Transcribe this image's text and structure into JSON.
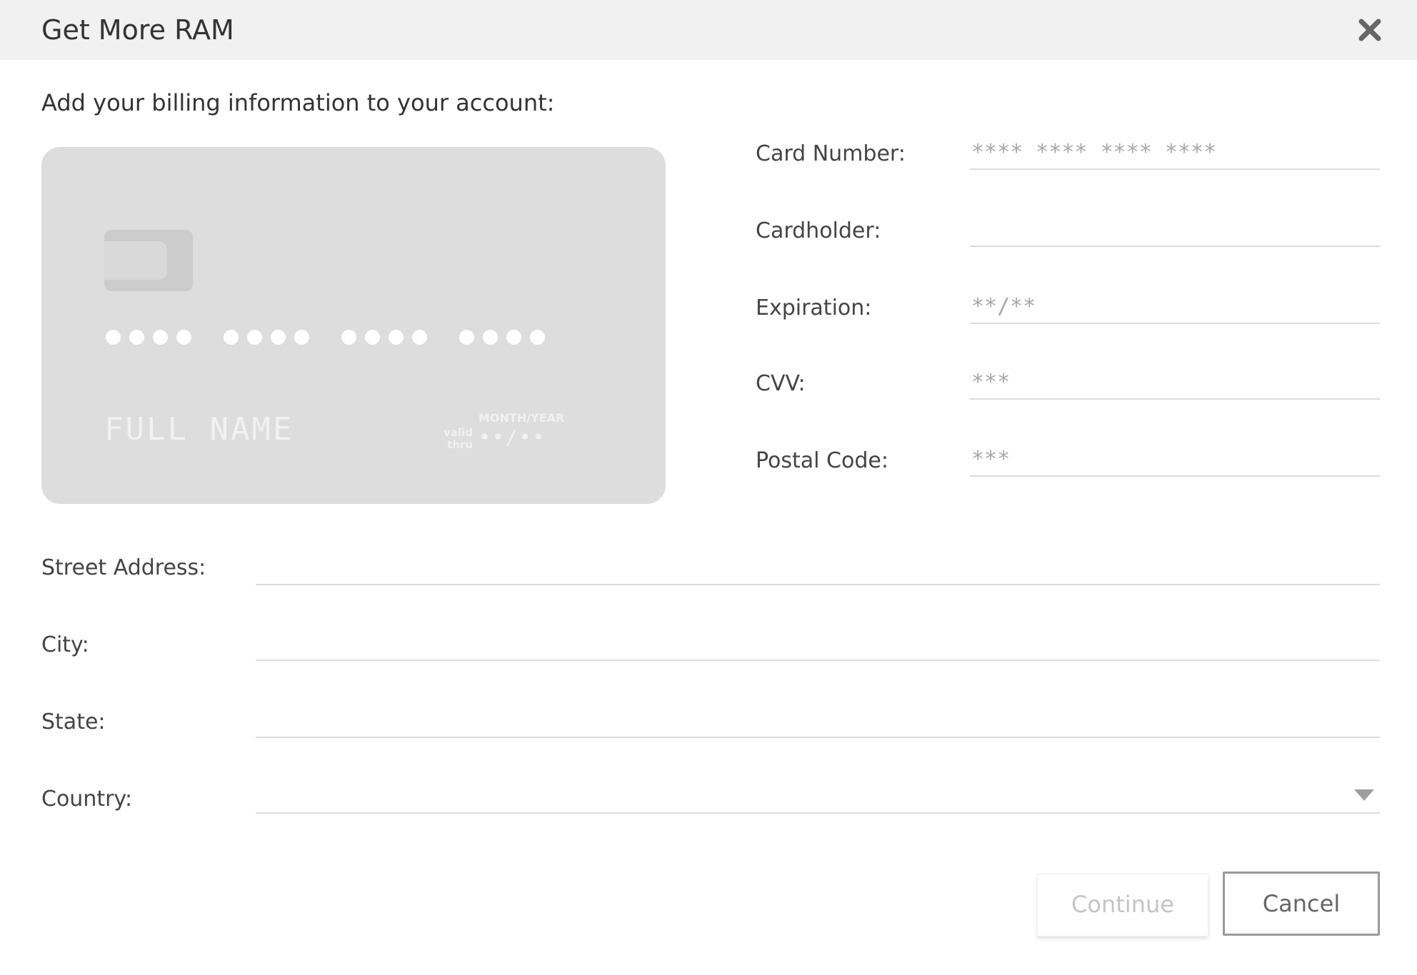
{
  "dialog": {
    "title": "Get More RAM",
    "close_icon": "close-icon",
    "intro": "Add your billing information to your account:"
  },
  "card_preview": {
    "number_mask": "•••• •••• •••• ••••",
    "name_placeholder": "FULL NAME",
    "valid_label_line1": "valid",
    "valid_label_line2": "thru",
    "expiry_label": "MONTH/YEAR",
    "expiry_mask": "••/••"
  },
  "card_fields": {
    "card_number": {
      "label": "Card Number:",
      "placeholder": "**** **** **** ****",
      "value": ""
    },
    "cardholder": {
      "label": "Cardholder:",
      "placeholder": "",
      "value": ""
    },
    "expiration": {
      "label": "Expiration:",
      "placeholder": "**/**",
      "value": ""
    },
    "cvv": {
      "label": "CVV:",
      "placeholder": "***",
      "value": ""
    },
    "postal_code": {
      "label": "Postal Code:",
      "placeholder": "***",
      "value": ""
    }
  },
  "address_fields": {
    "street": {
      "label": "Street Address:",
      "value": ""
    },
    "city": {
      "label": "City:",
      "value": ""
    },
    "state": {
      "label": "State:",
      "value": ""
    },
    "country": {
      "label": "Country:",
      "selected": ""
    }
  },
  "buttons": {
    "continue": "Continue",
    "cancel": "Cancel"
  },
  "colors": {
    "header_bg": "#f1f1f1",
    "card_bg": "#dddddd",
    "field_border": "#dcdcdc",
    "placeholder": "#a8a8a8"
  }
}
